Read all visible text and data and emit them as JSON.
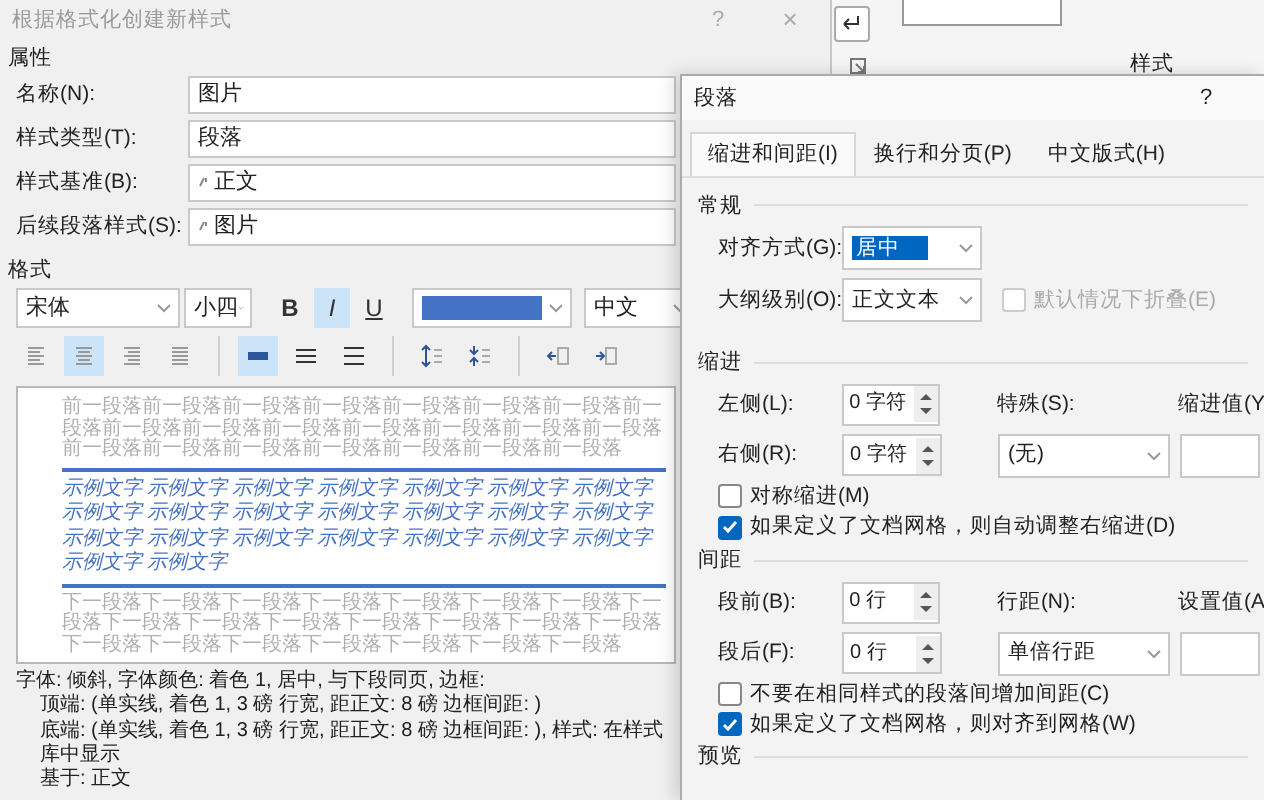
{
  "ribbon": {
    "group_label": "样式"
  },
  "style_dialog": {
    "title": "根据格式化创建新样式",
    "help": "?",
    "close": "×",
    "properties_heading": "属性",
    "properties": [
      {
        "label": "名称(N):",
        "value": "图片",
        "marked": false
      },
      {
        "label": "样式类型(T):",
        "value": "段落",
        "marked": false
      },
      {
        "label": "样式基准(B):",
        "value": "正文",
        "marked": true
      },
      {
        "label": "后续段落样式(S):",
        "value": "图片",
        "marked": true
      }
    ],
    "format_heading": "格式",
    "font": {
      "value": "宋体"
    },
    "size": {
      "value": "小四"
    },
    "style_buttons": [
      {
        "label": "B",
        "kind": "bold",
        "selected": false
      },
      {
        "label": "I",
        "kind": "italic",
        "selected": true
      },
      {
        "label": "U",
        "kind": "underline",
        "selected": false
      }
    ],
    "font_color": {
      "color": "#4472c4"
    },
    "language": {
      "value": "中文"
    },
    "alignment_buttons": [
      {
        "kind": "left",
        "selected": false
      },
      {
        "kind": "center",
        "selected": true
      },
      {
        "kind": "right",
        "selected": false
      },
      {
        "kind": "justify",
        "selected": false
      }
    ],
    "line_spacing_buttons": [
      {
        "kind": "single",
        "selected": true
      },
      {
        "kind": "one_half",
        "selected": false
      },
      {
        "kind": "double",
        "selected": false
      }
    ],
    "preview": {
      "previous": "前一段落前一段落前一段落前一段落前一段落前一段落前一段落前一段落前一段落前一段落前一段落前一段落前一段落前一段落前一段落前一段落前一段落前一段落前一段落前一段落前一段落前一段落",
      "sample_lines": [
        "示例文字 示例文字 示例文字 示例文字 示例文字 示例文字 示例文字",
        "示例文字 示例文字 示例文字 示例文字 示例文字 示例文字 示例文字",
        "示例文字 示例文字 示例文字 示例文字 示例文字 示例文字 示例文字",
        "示例文字 示例文字"
      ],
      "next": "下一段落下一段落下一段落下一段落下一段落下一段落下一段落下一段落下一段落下一段落下一段落下一段落下一段落下一段落下一段落下一段落下一段落下一段落下一段落下一段落下一段落下一段落"
    },
    "description": [
      {
        "text": "字体: 倾斜, 字体颜色: 着色 1, 居中, 与下段同页, 边框:",
        "indented": false
      },
      {
        "text": "顶端: (单实线, 着色 1,  3 磅 行宽, 距正文:  8 磅 边框间距: )",
        "indented": true
      },
      {
        "text": "底端: (单实线, 着色 1,  3 磅 行宽, 距正文:  8 磅 边框间距: ), 样式: 在样式库中显示",
        "indented": true
      },
      {
        "text": "基于: 正文",
        "indented": true
      }
    ]
  },
  "paragraph_dialog": {
    "title": "段落",
    "help": "?",
    "tabs": [
      {
        "label": "缩进和间距(I)",
        "selected": true
      },
      {
        "label": "换行和分页(P)",
        "selected": false
      },
      {
        "label": "中文版式(H)",
        "selected": false
      }
    ],
    "general": {
      "heading": "常规",
      "alignment": {
        "label": "对齐方式(G):",
        "value": "居中"
      },
      "outline": {
        "label": "大纲级别(O):",
        "value": "正文文本"
      },
      "collapse": {
        "label": "默认情况下折叠(E)",
        "checked": false,
        "disabled": true
      }
    },
    "indent": {
      "heading": "缩进",
      "left": {
        "label": "左侧(L):",
        "value": "0 字符"
      },
      "right": {
        "label": "右侧(R):",
        "value": "0 字符"
      },
      "special": {
        "label": "特殊(S):",
        "value": "(无)"
      },
      "by_label": "缩进值(Y",
      "checkboxes": [
        {
          "label": "对称缩进(M)",
          "checked": false
        },
        {
          "label": "如果定义了文档网格，则自动调整右缩进(D)",
          "checked": true
        }
      ]
    },
    "spacing": {
      "heading": "间距",
      "before": {
        "label": "段前(B):",
        "value": "0 行"
      },
      "after": {
        "label": "段后(F):",
        "value": "0 行"
      },
      "line": {
        "label": "行距(N):",
        "value": "单倍行距"
      },
      "at_label": "设置值(A",
      "checkboxes": [
        {
          "label": "不要在相同样式的段落间增加间距(C)",
          "checked": false
        },
        {
          "label": "如果定义了文档网格，则对齐到网格(W)",
          "checked": true
        }
      ]
    },
    "preview_heading": "预览"
  }
}
